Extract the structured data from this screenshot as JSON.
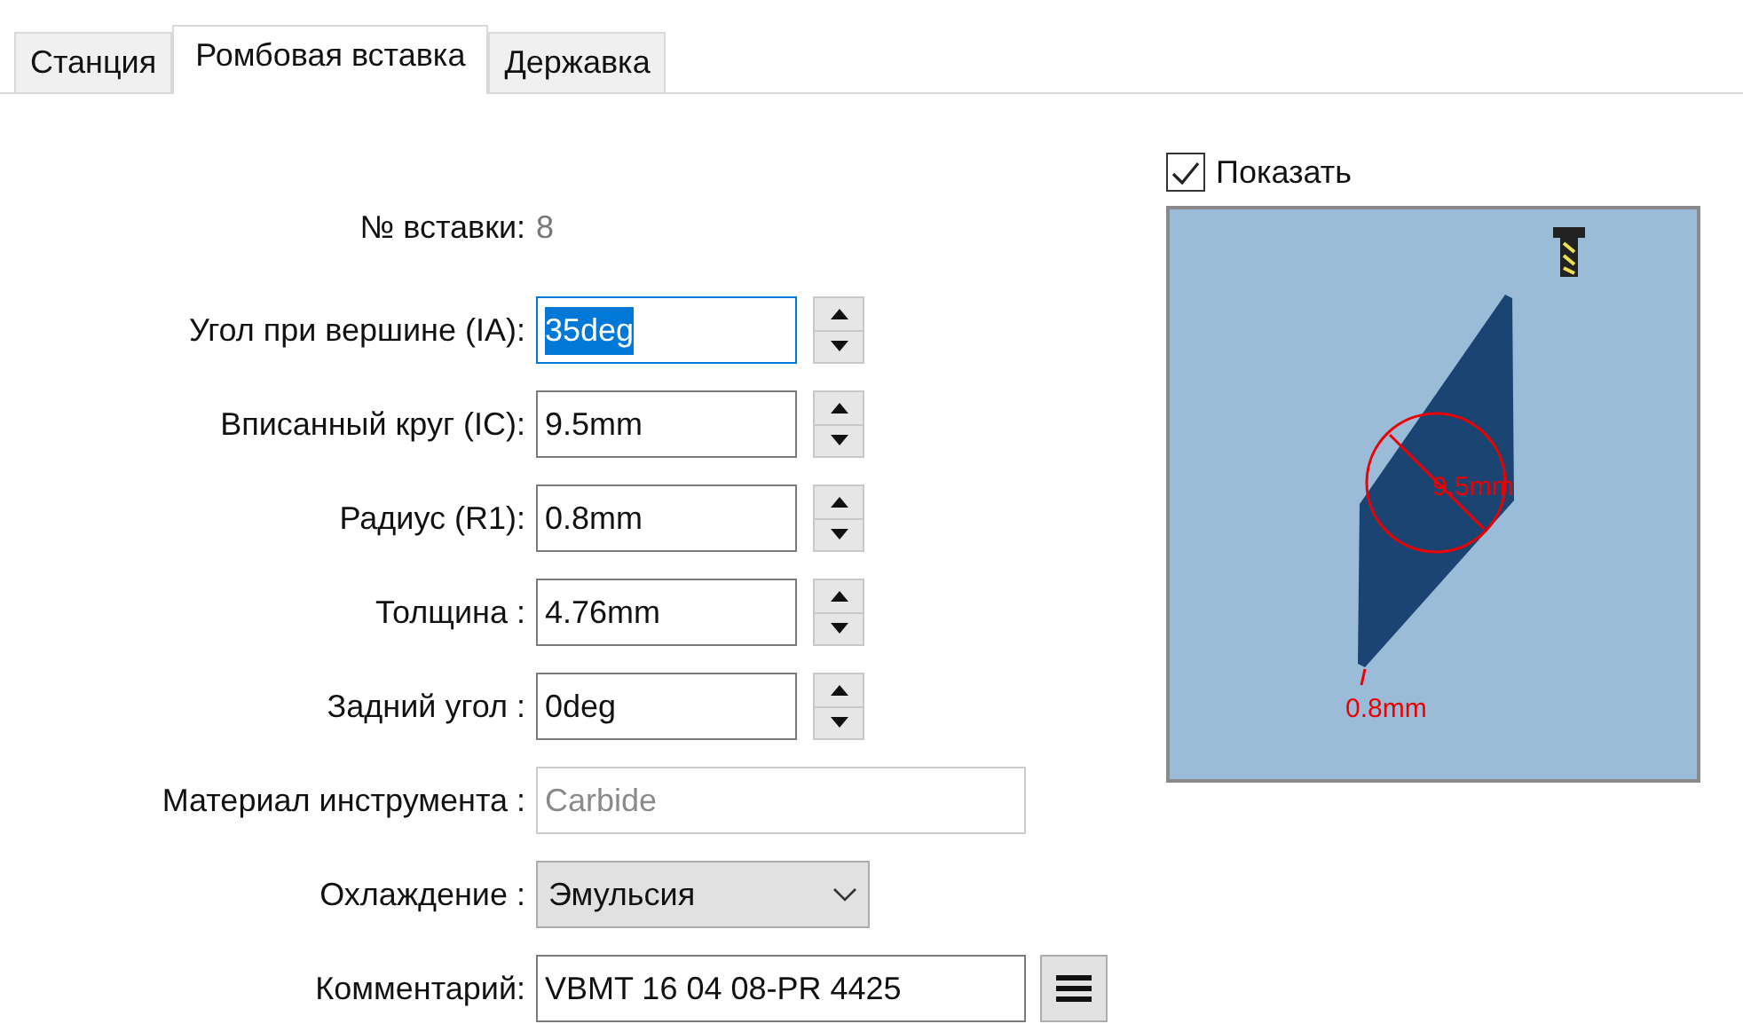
{
  "tabs": [
    {
      "label": "Станция",
      "selected": false
    },
    {
      "label": "Ромбовая вставка",
      "selected": true
    },
    {
      "label": "Державка",
      "selected": false
    }
  ],
  "insert_number": {
    "label": "№ вставки:",
    "value": "8"
  },
  "fields": [
    {
      "kind": "spin",
      "label": "Угол при вершине (IA):",
      "value": "35deg",
      "focused": true
    },
    {
      "kind": "spin",
      "label": "Вписанный круг (IC):",
      "value": "9.5mm",
      "focused": false
    },
    {
      "kind": "spin",
      "label": "Радиус (R1):",
      "value": "0.8mm",
      "focused": false
    },
    {
      "kind": "spin",
      "label": "Толщина :",
      "value": "4.76mm",
      "focused": false
    },
    {
      "kind": "spin",
      "label": "Задний угол :",
      "value": "0deg",
      "focused": false
    },
    {
      "kind": "text",
      "label": "Материал инструмента :",
      "value": "Carbide",
      "disabled": true
    },
    {
      "kind": "dropdown",
      "label": "Охлаждение :",
      "value": "Эмульсия"
    },
    {
      "kind": "comment",
      "label": "Комментарий:",
      "value": "VBMT 16 04 08-PR 4425"
    }
  ],
  "show": {
    "label": "Показать",
    "checked": true
  },
  "preview": {
    "circle_label": "9.5mm",
    "radius_label": "0.8mm"
  }
}
